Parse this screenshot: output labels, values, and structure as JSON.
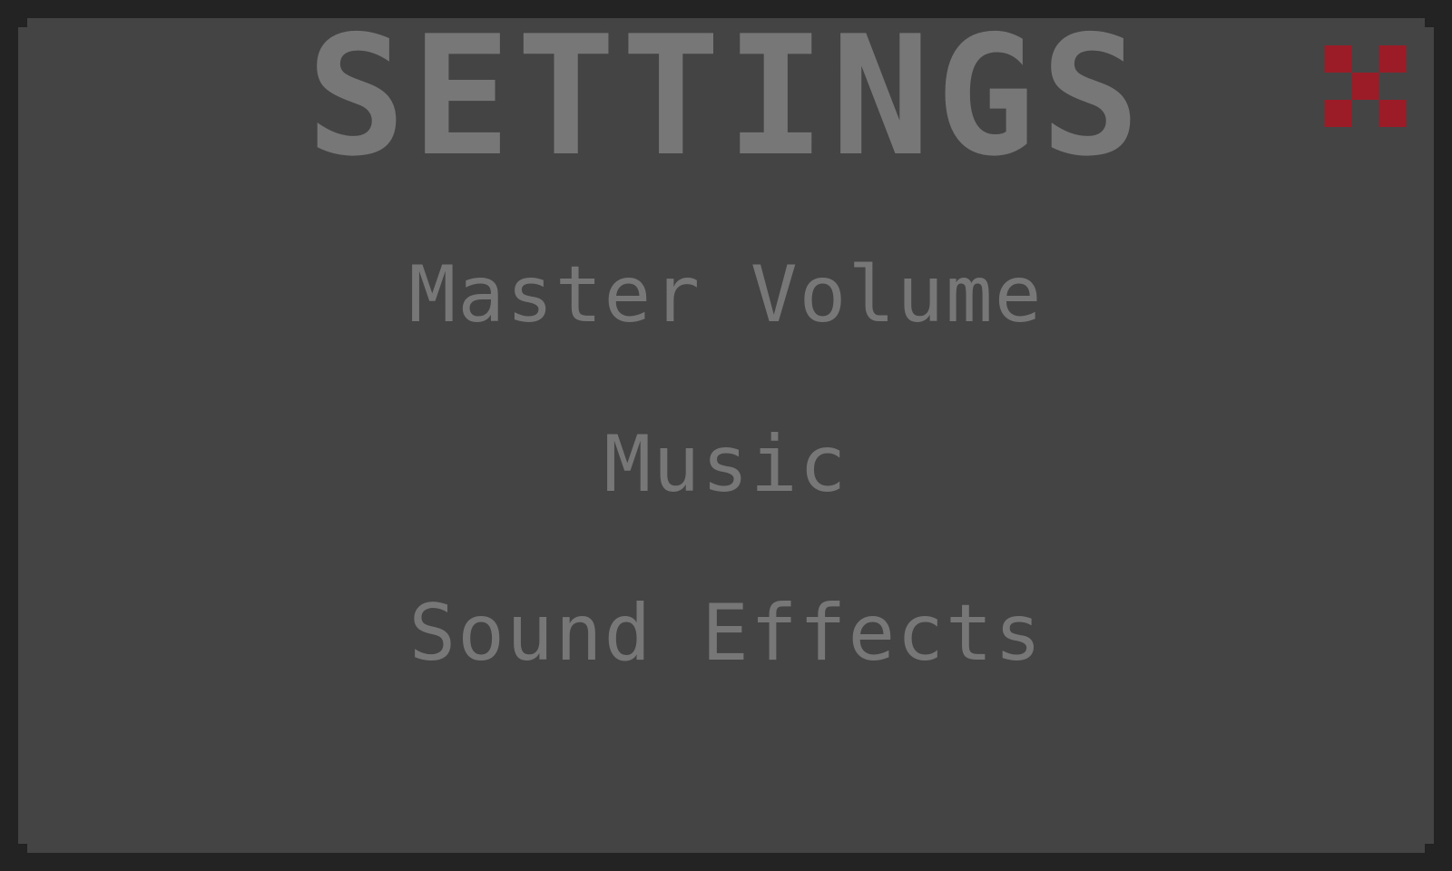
{
  "title": "SETTINGS",
  "menu": {
    "items": [
      {
        "label": "Master Volume"
      },
      {
        "label": "Music"
      },
      {
        "label": "Sound Effects"
      }
    ]
  },
  "close_button": {
    "icon": "close-icon",
    "color": "#9b1b26"
  },
  "colors": {
    "background": "#232323",
    "panel": "#444444",
    "text": "#777777",
    "close": "#9b1b26"
  }
}
